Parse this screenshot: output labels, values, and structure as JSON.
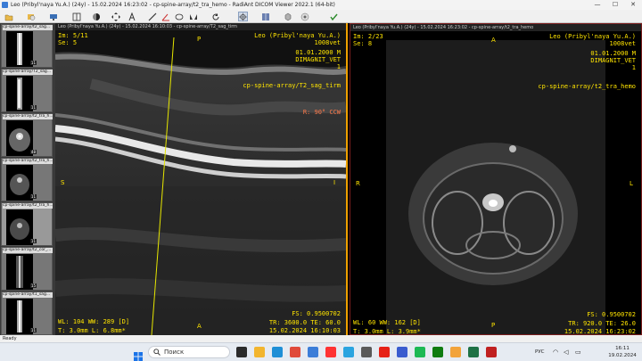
{
  "window": {
    "title": "Leo (Pribyl'naya Yu.A.) (24y) - 15.02.2024 16:23:02 - cp-spine-array/t2_tra_hemo - RadiAnt DICOM Viewer 2022.1 (64-bit)",
    "minimize": "—",
    "maximize": "☐",
    "close": "✕"
  },
  "toolbar": {
    "buttons": [
      {
        "name": "open-folder-icon"
      },
      {
        "name": "open-cd-icon"
      },
      {
        "name": "monitor-icon"
      },
      {
        "name": "layout-grid-icon"
      },
      {
        "name": "window-level-icon"
      },
      {
        "name": "pan-icon"
      },
      {
        "name": "zoom-icon"
      },
      {
        "name": "text-annotation-icon"
      },
      {
        "name": "measure-icon"
      },
      {
        "name": "angle-icon"
      },
      {
        "name": "ellipse-icon"
      },
      {
        "name": "crosshair-icon"
      },
      {
        "name": "flip-icon"
      },
      {
        "name": "rotate-icon"
      },
      {
        "name": "mpr-icon"
      },
      {
        "name": "3d-icon"
      },
      {
        "name": "reset-icon"
      },
      {
        "name": "export-icon"
      }
    ]
  },
  "thumbnails": [
    {
      "label": "cp-spine-array/t2_sag...",
      "count": "11"
    },
    {
      "label": "cp-spine-array/T2_sag...",
      "count": "11"
    },
    {
      "label": "cp-spine-array/t2_tra_h...",
      "count": "48"
    },
    {
      "label": "cp-spine-array/t2_tra_h...",
      "count": "11"
    },
    {
      "label": "cp-spine-array/t2_tra_h...",
      "count": "11"
    },
    {
      "label": "cp-spine-array/t2_cor_...",
      "count": "15"
    },
    {
      "label": "cp-spine-array/t1_sag...",
      "count": "11"
    }
  ],
  "viewport_left": {
    "header": "Leo (Pribyl'naya Yu.A.) (24y) - 15.02.2024 16:10:03 - cp-spine-array/T2_sag_tirm",
    "image": "Im: 5/11",
    "series": "Se:    5",
    "patient": "Leo (Pribyl'naya Yu.A.)",
    "patient_id": "1008vet",
    "birth": "01.01.2000 M",
    "institution": "DIMAGNIT_VET",
    "number": "1",
    "protocol": "cp-spine-array/T2_sag_tirm",
    "rotation": "R: 90° CCW",
    "orient_top": "P",
    "orient_left": "S",
    "orient_right": "I",
    "orient_bottom": "A",
    "wl": "WL: 104 WW: 289 [D]",
    "thickness": "T: 3.0mm L: 6.8mm*",
    "fs": "FS: 0.9500702",
    "tr": "TR: 3600.0 TE: 60.0",
    "datetime": "15.02.2024 16:10:03"
  },
  "viewport_right": {
    "header": "Leo (Pribyl'naya Yu.A.) (24y) - 15.02.2024 16:23:02 - cp-spine-array/t2_tra_hemo",
    "image": "Im: 2/23",
    "series": "Se:    8",
    "patient": "Leo (Pribyl'naya Yu.A.)",
    "patient_id": "1008vet",
    "birth": "01.01.2000 M",
    "institution": "DIMAGNIT_VET",
    "number": "1",
    "protocol": "cp-spine-array/t2_tra_hemo",
    "orient_top": "A",
    "orient_left": "R",
    "orient_right": "L",
    "orient_bottom": "P",
    "wl": "WL: 60 WW: 162 [D]",
    "thickness": "T: 3.0mm L: 3.9mm*",
    "fs": "FS: 0.9500702",
    "tr": "TR: 920.0 TE: 26.0",
    "datetime": "15.02.2024 16:23:02"
  },
  "statusbar": {
    "text": "Ready"
  },
  "taskbar": {
    "search_placeholder": "Поиск",
    "language": "РУС",
    "time": "16:11",
    "date": "19.02.2024",
    "apps": [
      {
        "name": "task-view-icon",
        "color": "#2b2b2b"
      },
      {
        "name": "explorer-icon",
        "color": "#f2b52e"
      },
      {
        "name": "edge-icon",
        "color": "#1f8fd6"
      },
      {
        "name": "chrome-icon",
        "color": "#e04a3a"
      },
      {
        "name": "mail-icon",
        "color": "#3b7dd8"
      },
      {
        "name": "yandex-icon",
        "color": "#ff3333"
      },
      {
        "name": "telegram-icon",
        "color": "#2aa4e0"
      },
      {
        "name": "store-icon",
        "color": "#5a5a5a"
      },
      {
        "name": "youtube-icon",
        "color": "#e62117"
      },
      {
        "name": "photos-icon",
        "color": "#3a5ccf"
      },
      {
        "name": "spotify-icon",
        "color": "#1db954"
      },
      {
        "name": "xbox-icon",
        "color": "#107c10"
      },
      {
        "name": "weather-icon",
        "color": "#f2a33a"
      },
      {
        "name": "excel-icon",
        "color": "#1e7145"
      },
      {
        "name": "radiant-icon",
        "color": "#c02020"
      }
    ]
  }
}
